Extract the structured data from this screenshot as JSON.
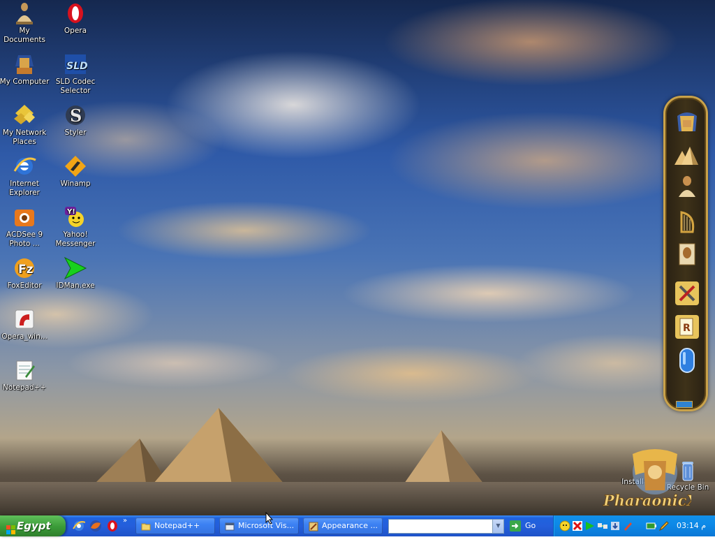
{
  "desktop_icons": [
    {
      "id": "my-documents",
      "label": "My Documents",
      "icon": "seated-scribe-icon"
    },
    {
      "id": "opera",
      "label": "Opera",
      "icon": "opera-icon"
    },
    {
      "id": "my-computer",
      "label": "My Computer",
      "icon": "pharaoh-computer-icon"
    },
    {
      "id": "sld-codec-selector",
      "label": "SLD Codec Selector",
      "icon": "sld-icon"
    },
    {
      "id": "my-network-places",
      "label": "My Network Places",
      "icon": "network-icon"
    },
    {
      "id": "styler",
      "label": "Styler",
      "icon": "styler-icon"
    },
    {
      "id": "internet-explorer",
      "label": "Internet Explorer",
      "icon": "ie-icon"
    },
    {
      "id": "winamp",
      "label": "Winamp",
      "icon": "winamp-icon"
    },
    {
      "id": "acdsee",
      "label": "ACDSee 9 Photo ...",
      "icon": "acdsee-icon"
    },
    {
      "id": "yahoo-messenger",
      "label": "Yahoo! Messenger",
      "icon": "yahoo-icon"
    },
    {
      "id": "foxeditor",
      "label": "FoxEditor",
      "icon": "foxeditor-icon"
    },
    {
      "id": "idman",
      "label": "IDMan.exe",
      "icon": "idm-arrow-icon"
    },
    {
      "id": "opera-win",
      "label": "Opera_win...",
      "icon": "opera-installer-icon"
    },
    {
      "id": "notepadpp",
      "label": "Notepad++",
      "icon": "notepad-icon"
    }
  ],
  "right_icons": [
    {
      "id": "install",
      "label": "Install",
      "icon": "install-icon"
    },
    {
      "id": "recycle-bin",
      "label": "Recycle Bin",
      "icon": "recycle-bin-icon"
    }
  ],
  "logo": {
    "text": "PharaonicXp"
  },
  "dock": {
    "items": [
      "tutankhamun-mask-icon",
      "pyramids-icon",
      "seated-scribe-icon",
      "harp-icon",
      "papyrus-book-icon",
      "tools-icon",
      "documents-icon",
      "blue-capsule-icon"
    ]
  },
  "taskbar": {
    "start_label": "Egypt",
    "quick_launch": [
      "ie-icon",
      "firefox-icon",
      "opera-icon"
    ],
    "tasks": [
      {
        "label": "Notepad++",
        "icon": "folder-icon"
      },
      {
        "label": "Microsoft Vis...",
        "icon": "app-window-icon"
      },
      {
        "label": "Appearance ...",
        "icon": "appearance-icon"
      }
    ],
    "address": {
      "value": ""
    },
    "go_label": "Go",
    "tray_icons": [
      "messenger-icon",
      "antivirus-icon",
      "winamp-play-icon",
      "network-tray-icon",
      "idm-tray-icon",
      "rocket-icon",
      "battery-icon",
      "pencil-tray-icon"
    ],
    "clock": "03:14 م"
  }
}
